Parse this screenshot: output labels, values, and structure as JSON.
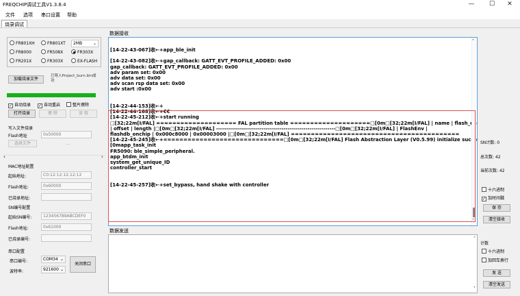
{
  "window": {
    "title": "FREQCHIP调试工具V1.3.8.4",
    "minimize": "—",
    "maximize": "☐",
    "close": "✕"
  },
  "menu": [
    "文件",
    "选项",
    "串口设置",
    "帮助"
  ],
  "tab": "烧录调试",
  "chips": {
    "options": [
      "FR801XH",
      "FR801XT",
      "FR8000",
      "FR508X",
      "FR303X",
      "FR201X",
      "FR303X",
      "EX-FLASH"
    ],
    "selected": "FR303X",
    "dropdown_value": "2MB"
  },
  "burn": {
    "add_button": "加载烧录文件",
    "loaded_file": "已导入Project_burn.bin成功",
    "progress_percent": 100,
    "auto_burn": "自动烧录",
    "auto_reset": "自动重启",
    "chip_erase": "整片擦除",
    "open_burn": "打开烧录",
    "erase": "擦 除",
    "read": "读 取",
    "burn": "烧 录"
  },
  "write_file": {
    "title": "写入文件烧录",
    "flash_addr_label": "Flash地址",
    "flash_addr_value": "0x50000",
    "select_file": "选择文件",
    "dots": "..."
  },
  "mac": {
    "title": "MAC地址配置",
    "start_label": "起始地址:",
    "start_value": "C0:12:12:12:12:12",
    "flash_label": "Flash地址:",
    "flash_value": "0x60000",
    "burned_label": "已烧录地址:"
  },
  "sn": {
    "title": "SN编号配置",
    "start_label": "起始SN编号:",
    "start_value": "123456789ABCDEF0",
    "flash_label": "Flash地址:",
    "flash_value": "0x61000",
    "burned_label": "已烧录编号:"
  },
  "serial": {
    "title": "串口配置",
    "port_label": "串口编号:",
    "port_value": "COM34",
    "baud_label": "波特率:",
    "baud_value": "921600",
    "close_button": "关闭串口"
  },
  "receive": {
    "header": "数据接收",
    "lines": [
      "[14-22-43-067]收←+app_ble_init",
      "",
      "[14-22-43-082]收←+gap_callback: GATT_EVT_PROFILE_ADDED: 0x00",
      "gap_callback: GATT_EVT_PROFILE_ADDED: 0x00",
      "adv param set: 0x00",
      "adv data set: 0x00",
      "adv scan rsp data set: 0x00",
      "adv start :0x00",
      "",
      "",
      "[14-22-44-153]收←+",
      "[14-22-44-168]收←+€€",
      "[14-22-45-212]收←+start running",
      "□[32;22m[I/FAL] ==================== FAL partition table ====================□[0m□[32;22m[I/FAL] | name     | flash_dev",
      "     |   offset   |    length   |□[0m□[32;22m[I/FAL] ------------------------------------------------------------□[0m□[32;22m[I/FAL] | FlashEnv |",
      "flashdb_onchip | 0x000c8000 | 0x00003000 |□[0m□[32;22m[I/FAL] ==========================================",
      "[14-22-45-245]收←+==============================□[0m□[32;22m[I/FAL] Flash Abstraction Layer (V0.5.99) initialize success.□",
      "[0mapp_task_init",
      "FR5090: ble_simple_peripheral.",
      "app_btdm_init",
      "system_get_unique_ID",
      "controller_start",
      "",
      "",
      "[14-22-45-257]收←+set_bypass, hand shake with controller"
    ]
  },
  "send": {
    "header": "数据发送"
  },
  "stats": {
    "sn_count": "SN计数: 0",
    "total": "总次数: 42",
    "current": "当前次数: 42"
  },
  "right_controls": {
    "hex": "十六进制",
    "timestamp": "加时间戳",
    "save": "保 存",
    "clear_rx": "清空接收",
    "count": "计数",
    "hex_send": "十六进制",
    "add_crlf": "加回车换行",
    "send": "发 送",
    "clear_tx": "清空发送"
  }
}
